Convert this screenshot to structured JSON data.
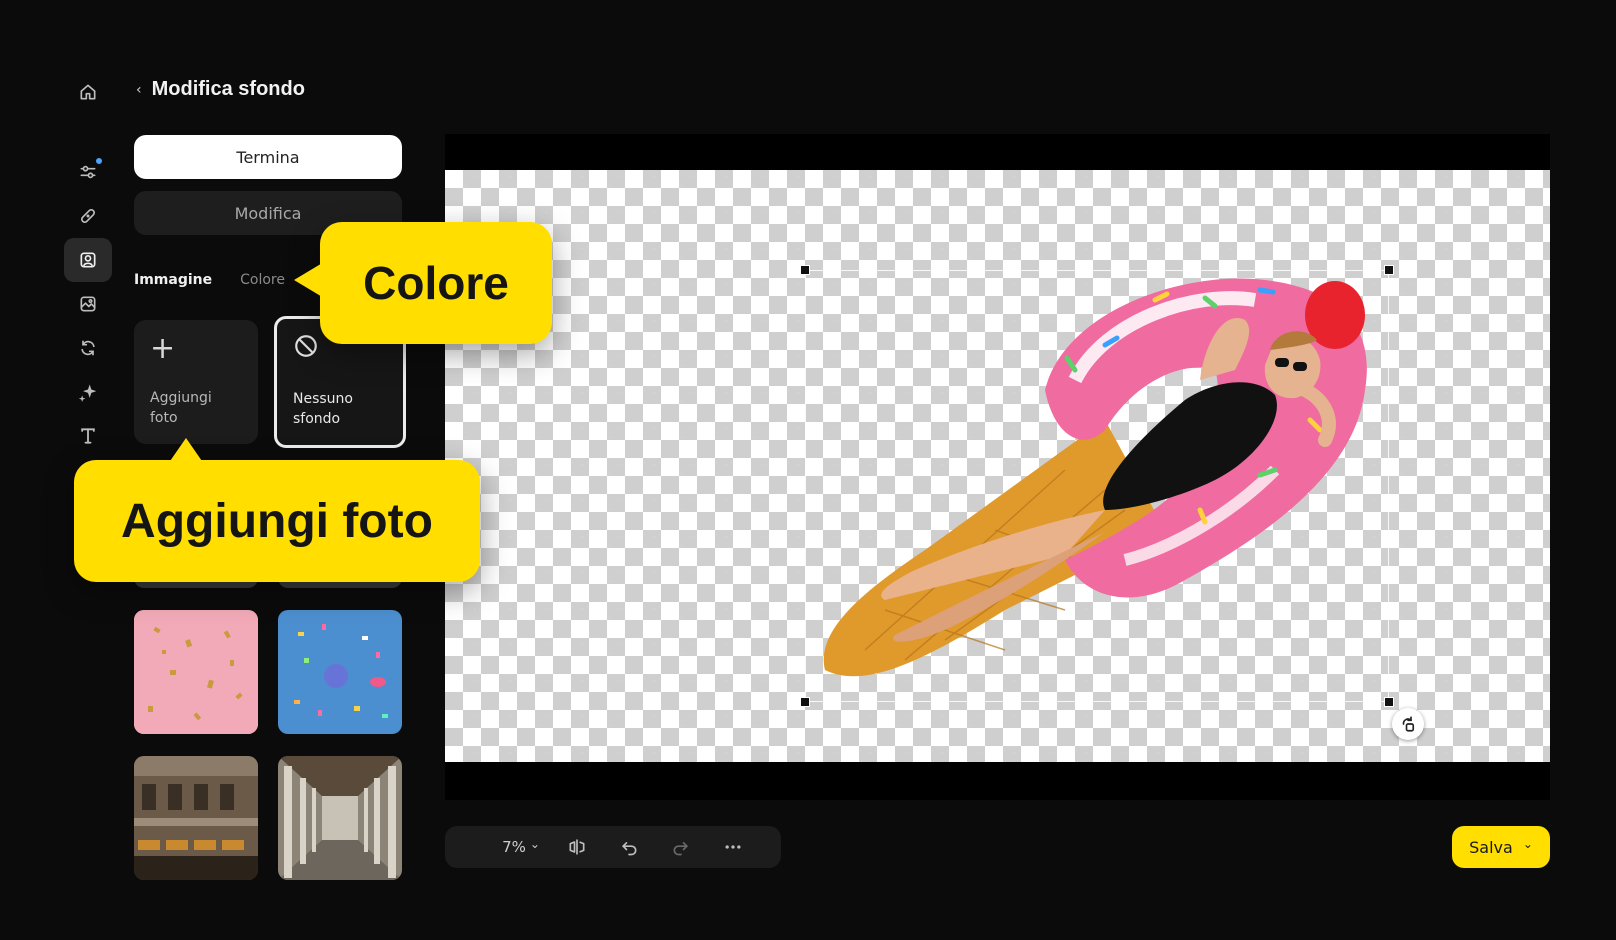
{
  "header": {
    "back_glyph": "‹",
    "title": "Modifica sfondo"
  },
  "rail": {
    "items": [
      {
        "icon": "home-icon"
      },
      {
        "icon": "sliders-icon",
        "badge": true
      },
      {
        "icon": "bandage-icon"
      },
      {
        "icon": "portrait-icon",
        "active": true
      },
      {
        "icon": "image-edit-icon"
      },
      {
        "icon": "rotate-icon"
      },
      {
        "icon": "sparkle-icon"
      },
      {
        "icon": "text-icon"
      }
    ]
  },
  "panel": {
    "finish_label": "Termina",
    "edit_label": "Modifica",
    "tabs": [
      {
        "label": "Immagine",
        "active": true
      },
      {
        "label": "Colore",
        "active": false
      }
    ],
    "cards": [
      {
        "glyph": "+",
        "label_line1": "Aggiungi",
        "label_line2": "foto"
      },
      {
        "icon": "no-background-icon",
        "label_line1": "Nessuno",
        "label_line2": "sfondo",
        "selected": true
      }
    ],
    "thumbnails": [
      {
        "desc": "pink-confetti-icon"
      },
      {
        "desc": "blue-confetti-icon"
      },
      {
        "desc": "building-facade-icon"
      },
      {
        "desc": "colonnade-icon"
      }
    ]
  },
  "callouts": {
    "color": "Colore",
    "add_photo": "Aggiungi foto"
  },
  "toolbar": {
    "zoom": "7%",
    "chevron": "⌄"
  },
  "save": {
    "label": "Salva",
    "chevron": "⌄"
  },
  "colors": {
    "accent": "#ffde00",
    "background": "#0b0b0b",
    "panel": "#1c1c1c",
    "badge": "#4ea3ff"
  }
}
